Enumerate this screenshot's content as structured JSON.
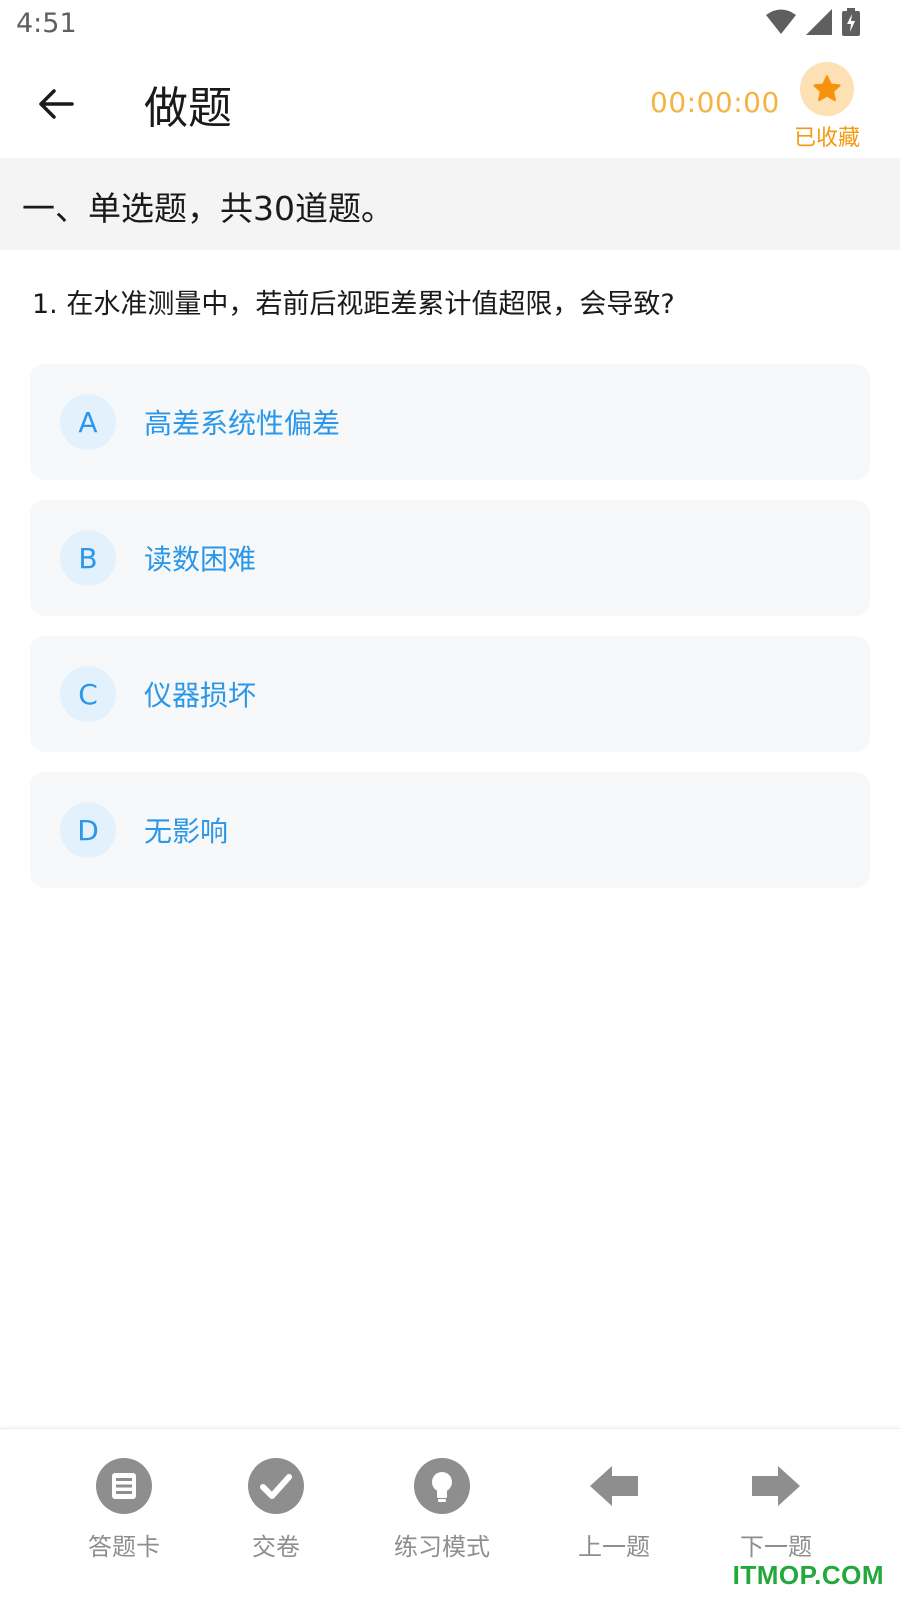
{
  "status_bar": {
    "time": "4:51"
  },
  "header": {
    "title": "做题",
    "timer": "00:00:00",
    "favorite_label": "已收藏"
  },
  "section": {
    "title": "一、单选题，共30道题。"
  },
  "question": {
    "text": "1. 在水准测量中，若前后视距差累计值超限，会导致?"
  },
  "options": [
    {
      "letter": "A",
      "text": "高差系统性偏差"
    },
    {
      "letter": "B",
      "text": "读数困难"
    },
    {
      "letter": "C",
      "text": "仪器损坏"
    },
    {
      "letter": "D",
      "text": "无影响"
    }
  ],
  "bottom_nav": [
    {
      "label": "答题卡",
      "icon": "answer-card-icon"
    },
    {
      "label": "交卷",
      "icon": "submit-check-icon"
    },
    {
      "label": "练习模式",
      "icon": "lightbulb-icon"
    },
    {
      "label": "上一题",
      "icon": "arrow-left-icon"
    },
    {
      "label": "下一题",
      "icon": "arrow-right-icon"
    }
  ],
  "watermark": "ITMOP.COM",
  "colors": {
    "accent_blue": "#2a97e8",
    "timer_orange": "#f5b342",
    "favorite_orange": "#f19a12",
    "icon_gray": "#8e8e8e"
  }
}
